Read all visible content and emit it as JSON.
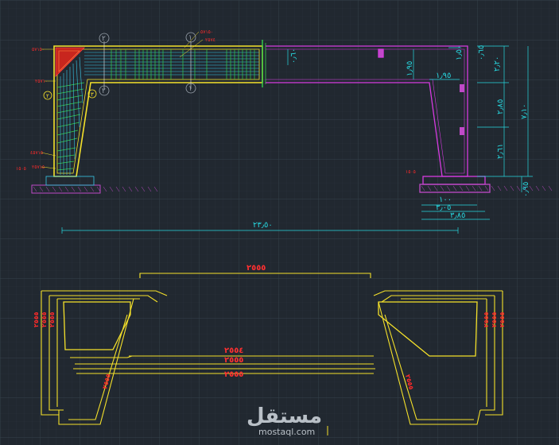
{
  "colors": {
    "background": "#212830",
    "grid_minor": "#2a323c",
    "grid_major": "#35404b",
    "rebar": "#f5e12a",
    "frame_magenta": "#d63be0",
    "dimension": "#27d8e0",
    "label": "#ff2a2a",
    "mesh_green": "#33d04a",
    "stirrup_cyan": "#38c8e8",
    "concrete_red": "#c8261e",
    "footing_magenta": "#c04ac8",
    "watermark": "#b9c0c7"
  },
  "elevation": {
    "section_marks": [
      "٢",
      "١",
      "١",
      "٢"
    ],
    "detail_marks": [
      "٢",
      "٣"
    ],
    "bar_labels_left": [
      "٥٧١٥٠",
      "٢٥٧١٠",
      "٤٥٧١٥",
      "٢٥٧١٥"
    ],
    "bar_labels_top": [
      "٥٧١٥٠",
      "٢٥٧٤"
    ],
    "footing_labels": [
      "١٥٠٥",
      "١٥٠٥"
    ],
    "right_dims_vertical": [
      "٢٫٢٠",
      "٢٫٨٥",
      "٢٫٦١",
      "٧٫١٠",
      "٠٫٩٥"
    ],
    "beam_dims": [
      "٠٫٦٠",
      "١٫٩٥",
      "١٫٩٥",
      "٠٫٦٥",
      "١٫٥٠"
    ],
    "bottom_dims": [
      "١٠٠",
      "٣٫٠٥",
      "٣٫٨٥"
    ],
    "overall_span": "٢٣٫٥٠"
  },
  "rebar_detail": {
    "top_bar": "٢٥٥٥",
    "middle_bars": [
      "٢٥٥٤",
      "٢٥٥٥",
      "٢٥٥٥"
    ],
    "left_column_labels": [
      "٢٥٥٥",
      "٢٥٥٥",
      "٢٥٥٥"
    ],
    "right_column_labels": [
      "٢٥٥٥",
      "٢٥٥٥",
      "٢٥٥٥"
    ],
    "diagonal_label_left": "٢٥٥٥",
    "diagonal_label_right": "٢٥٥٥"
  },
  "watermark": {
    "arabic": "مستقل",
    "latin": "mostaql.com"
  }
}
